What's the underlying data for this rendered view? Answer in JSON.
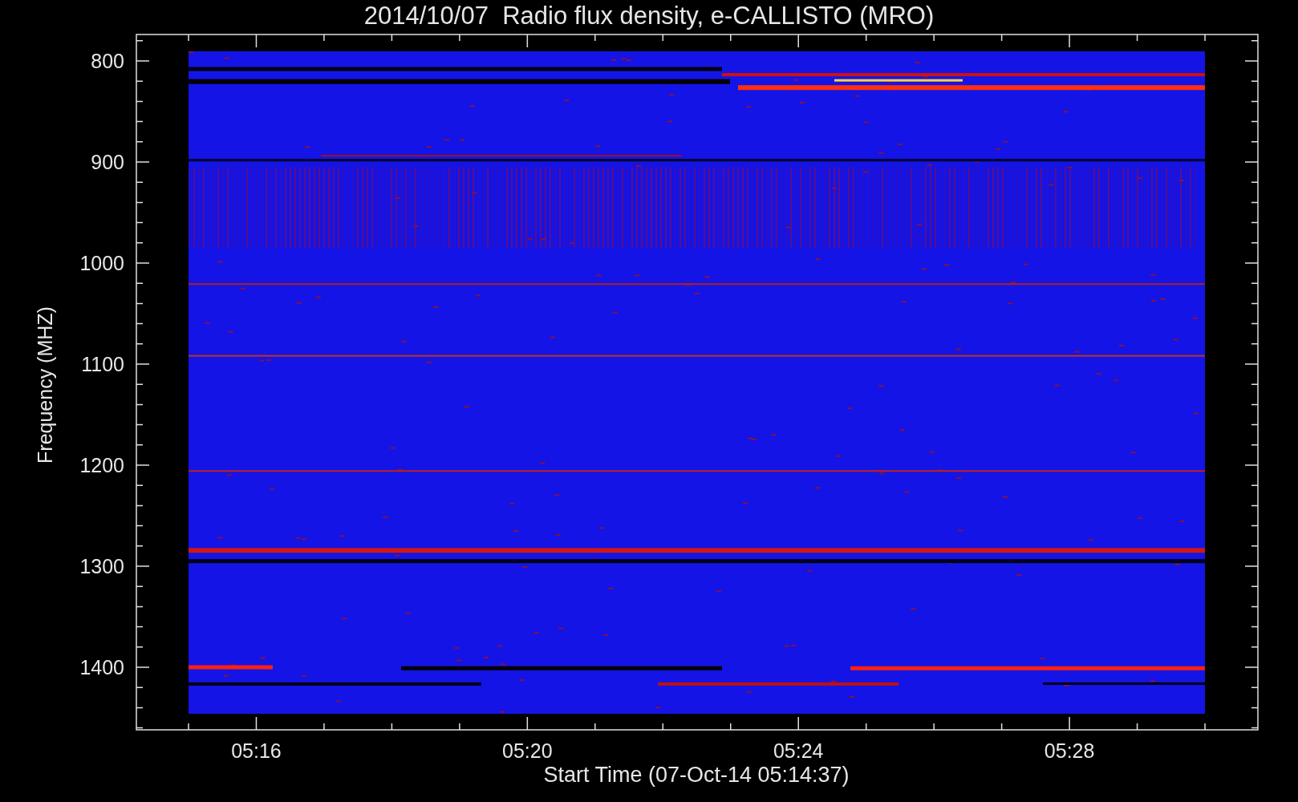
{
  "title": "2014/10/07  Radio flux density, e-CALLISTO (MRO)",
  "y_axis": {
    "label": "Frequency (MHZ)",
    "ticks": [
      "800",
      "900",
      "1000",
      "1100",
      "1200",
      "1300",
      "1400"
    ]
  },
  "x_axis": {
    "label": "Start Time (07-Oct-14 05:14:37)",
    "ticks": [
      "05:16",
      "05:20",
      "05:24",
      "05:28"
    ]
  }
}
